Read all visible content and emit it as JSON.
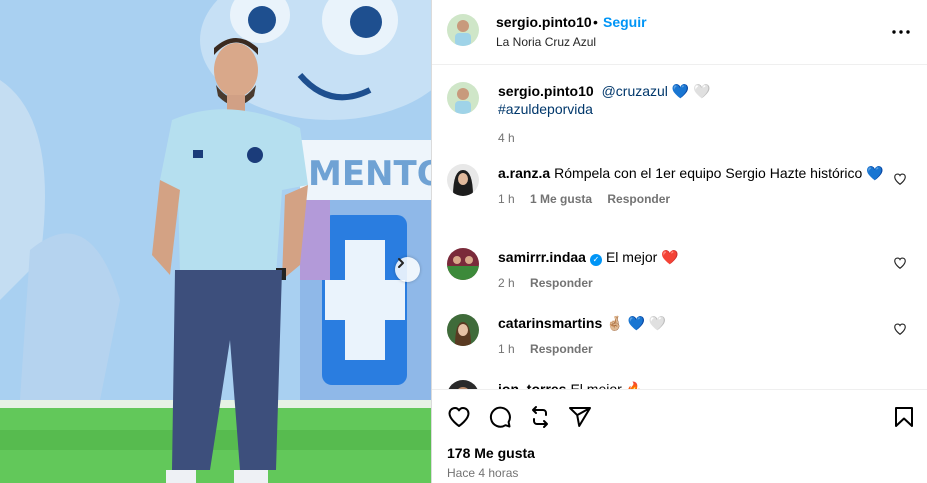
{
  "post": {
    "username": "sergio.pinto10",
    "follow_label": "Seguir",
    "separator": "•",
    "location": "La Noria Cruz Azul"
  },
  "caption": {
    "username": "sergio.pinto10",
    "mention": "@cruzazul",
    "emojis": "💙 🤍",
    "hashtag": "#azuldeporvida",
    "time": "4 h"
  },
  "comments": [
    {
      "username": "a.ranz.a",
      "text": "Rómpela con el 1er equipo Sergio Hazte histórico 💙",
      "time": "1 h",
      "likes": "1 Me gusta",
      "reply": "Responder"
    },
    {
      "username": "samirrr.indaa",
      "verified": true,
      "text": "El mejor ❤️",
      "time": "2 h",
      "reply": "Responder"
    },
    {
      "username": "catarinsmartins",
      "text": "🤞🏼 💙 🤍",
      "time": "1 h",
      "reply": "Responder"
    },
    {
      "username": "jon_torres",
      "text": "El mejor 🔥"
    }
  ],
  "footer": {
    "likes": "178 Me gusta",
    "when": "Hace 4 horas"
  },
  "icons": {
    "more": "more-options-icon",
    "like": "heart-icon",
    "comment": "comment-icon",
    "repost": "repost-icon",
    "share": "share-icon",
    "save": "bookmark-icon",
    "next": "chevron-right-icon"
  },
  "colors": {
    "accent": "#0095f6",
    "link": "#00376b",
    "muted": "#737373"
  }
}
